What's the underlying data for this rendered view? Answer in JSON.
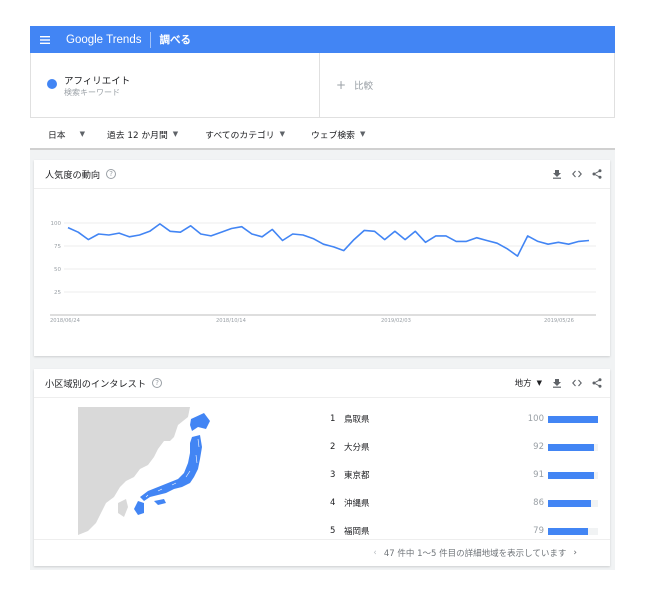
{
  "header": {
    "logo_google": "Google",
    "logo_trends": "Trends",
    "explore_label": "調べる"
  },
  "search": {
    "term_name": "アフィリエイト",
    "term_type": "検索キーワード",
    "compare_label": "比較",
    "term_color": "#4285f4"
  },
  "filters": [
    {
      "label": "日本"
    },
    {
      "label": "過去 12 か月間"
    },
    {
      "label": "すべてのカテゴリ"
    },
    {
      "label": "ウェブ検索"
    }
  ],
  "interest_over_time": {
    "title": "人気度の動向"
  },
  "chart_data": {
    "type": "line",
    "title": "人気度の動向",
    "xlabel": "",
    "ylabel": "",
    "ylim": [
      0,
      100
    ],
    "yticks": [
      "100",
      "75",
      "50",
      "25"
    ],
    "grid": true,
    "x_tick_labels": [
      "2018/06/24",
      "2018/10/14",
      "2019/02/03",
      "2019/05/26"
    ],
    "series": [
      {
        "color": "#4285f4",
        "values": [
          95,
          90,
          82,
          88,
          87,
          89,
          85,
          87,
          91,
          99,
          91,
          90,
          97,
          88,
          86,
          90,
          94,
          96,
          88,
          85,
          93,
          81,
          88,
          87,
          83,
          77,
          74,
          70,
          82,
          92,
          91,
          82,
          91,
          82,
          91,
          79,
          86,
          86,
          80,
          80,
          84,
          81,
          78,
          72,
          64,
          86,
          80,
          77,
          79,
          77,
          80,
          81
        ]
      }
    ]
  },
  "region": {
    "title": "小区域別のインタレスト",
    "selector_label": "地方",
    "items": [
      {
        "rank": "1",
        "name": "鳥取県",
        "value": 100
      },
      {
        "rank": "2",
        "name": "大分県",
        "value": 92
      },
      {
        "rank": "3",
        "name": "東京都",
        "value": 91
      },
      {
        "rank": "4",
        "name": "沖縄県",
        "value": 86
      },
      {
        "rank": "5",
        "name": "福岡県",
        "value": 79
      }
    ],
    "pagination_text": "47 件中 1〜5 件目の詳細地域を表示しています"
  }
}
